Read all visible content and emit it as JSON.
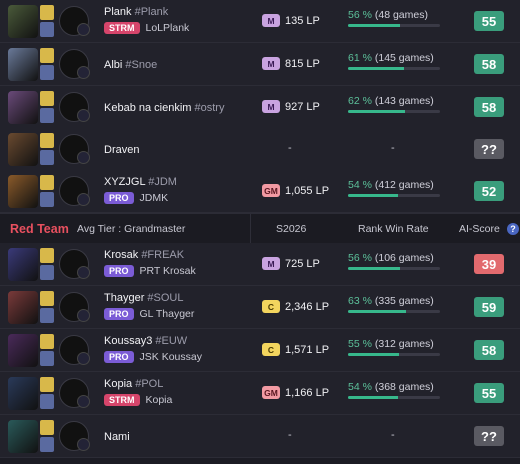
{
  "blue_team": {
    "players": [
      {
        "name": "Plank",
        "tag": "#Plank",
        "badge": "STRM",
        "alias": "LoLPlank",
        "tier_icon": "M",
        "lp": "135 LP",
        "wr_pct": "56 %",
        "wr_games": "(48 games)",
        "wr_value": 56,
        "score": "55",
        "score_color": "green",
        "champion": "champion-portrait",
        "champ_color": "#4a5a3a"
      },
      {
        "name": "Albi",
        "tag": "#Snoe",
        "badge": "",
        "alias": "",
        "tier_icon": "M",
        "lp": "815 LP",
        "wr_pct": "61 %",
        "wr_games": "(145 games)",
        "wr_value": 61,
        "score": "58",
        "score_color": "green",
        "champion": "champion-portrait",
        "champ_color": "#6a7a9a"
      },
      {
        "name": "Kebab na cienkim",
        "tag": "#ostry",
        "badge": "",
        "alias": "",
        "tier_icon": "M",
        "lp": "927 LP",
        "wr_pct": "62 %",
        "wr_games": "(143 games)",
        "wr_value": 62,
        "score": "58",
        "score_color": "green",
        "champion": "champion-portrait",
        "champ_color": "#6a4a7a"
      },
      {
        "name": "Draven",
        "tag": "",
        "badge": "",
        "alias": "",
        "tier_icon": "",
        "lp": "-",
        "wr_pct": "",
        "wr_games": "-",
        "wr_value": 0,
        "score": "??",
        "score_color": "gray",
        "champion": "champion-portrait",
        "champ_color": "#6a4a30"
      },
      {
        "name": "XYZJGL",
        "tag": "#JDM",
        "badge": "PRO",
        "alias": "JDMK",
        "tier_icon": "GM",
        "lp": "1,055 LP",
        "wr_pct": "54 %",
        "wr_games": "(412 games)",
        "wr_value": 54,
        "score": "52",
        "score_color": "green",
        "champion": "champion-portrait",
        "champ_color": "#8a5a2a"
      }
    ]
  },
  "red_header": {
    "team_label": "Red Team",
    "avg_tier": "Avg Tier : Grandmaster",
    "col_season": "S2026",
    "col_winrate": "Rank Win Rate",
    "col_score": "AI-Score"
  },
  "red_team": {
    "players": [
      {
        "name": "Krosak",
        "tag": "#FREAK",
        "badge": "PRO",
        "alias": "PRT Krosak",
        "tier_icon": "M",
        "lp": "725 LP",
        "wr_pct": "56 %",
        "wr_games": "(106 games)",
        "wr_value": 56,
        "score": "39",
        "score_color": "red",
        "champion": "champion-portrait",
        "champ_color": "#3a3a7a"
      },
      {
        "name": "Thayger",
        "tag": "#SOUL",
        "badge": "PRO",
        "alias": "GL Thayger",
        "tier_icon": "C",
        "lp": "2,346 LP",
        "wr_pct": "63 %",
        "wr_games": "(335 games)",
        "wr_value": 63,
        "score": "59",
        "score_color": "green",
        "champion": "champion-portrait",
        "champ_color": "#7a3a3a"
      },
      {
        "name": "Koussay3",
        "tag": "#EUW",
        "badge": "PRO",
        "alias": "JSK Koussay",
        "tier_icon": "C",
        "lp": "1,571 LP",
        "wr_pct": "55 %",
        "wr_games": "(312 games)",
        "wr_value": 55,
        "score": "58",
        "score_color": "green",
        "champion": "champion-portrait",
        "champ_color": "#4a2a5a"
      },
      {
        "name": "Kopia",
        "tag": "#POL",
        "badge": "STRM",
        "alias": "Kopia",
        "tier_icon": "GM",
        "lp": "1,166 LP",
        "wr_pct": "54 %",
        "wr_games": "(368 games)",
        "wr_value": 54,
        "score": "55",
        "score_color": "green",
        "champion": "champion-portrait",
        "champ_color": "#2a3a5a"
      },
      {
        "name": "Nami",
        "tag": "",
        "badge": "",
        "alias": "",
        "tier_icon": "",
        "lp": "-",
        "wr_pct": "",
        "wr_games": "-",
        "wr_value": 0,
        "score": "??",
        "score_color": "gray",
        "champion": "champion-portrait",
        "champ_color": "#2a5a5a"
      }
    ]
  },
  "colors": {
    "accent_green": "#37b88c",
    "red_team": "#e8505f",
    "score_red": "#e26a6e",
    "score_gray": "#5a5a62"
  },
  "icons": {
    "help": "?"
  }
}
